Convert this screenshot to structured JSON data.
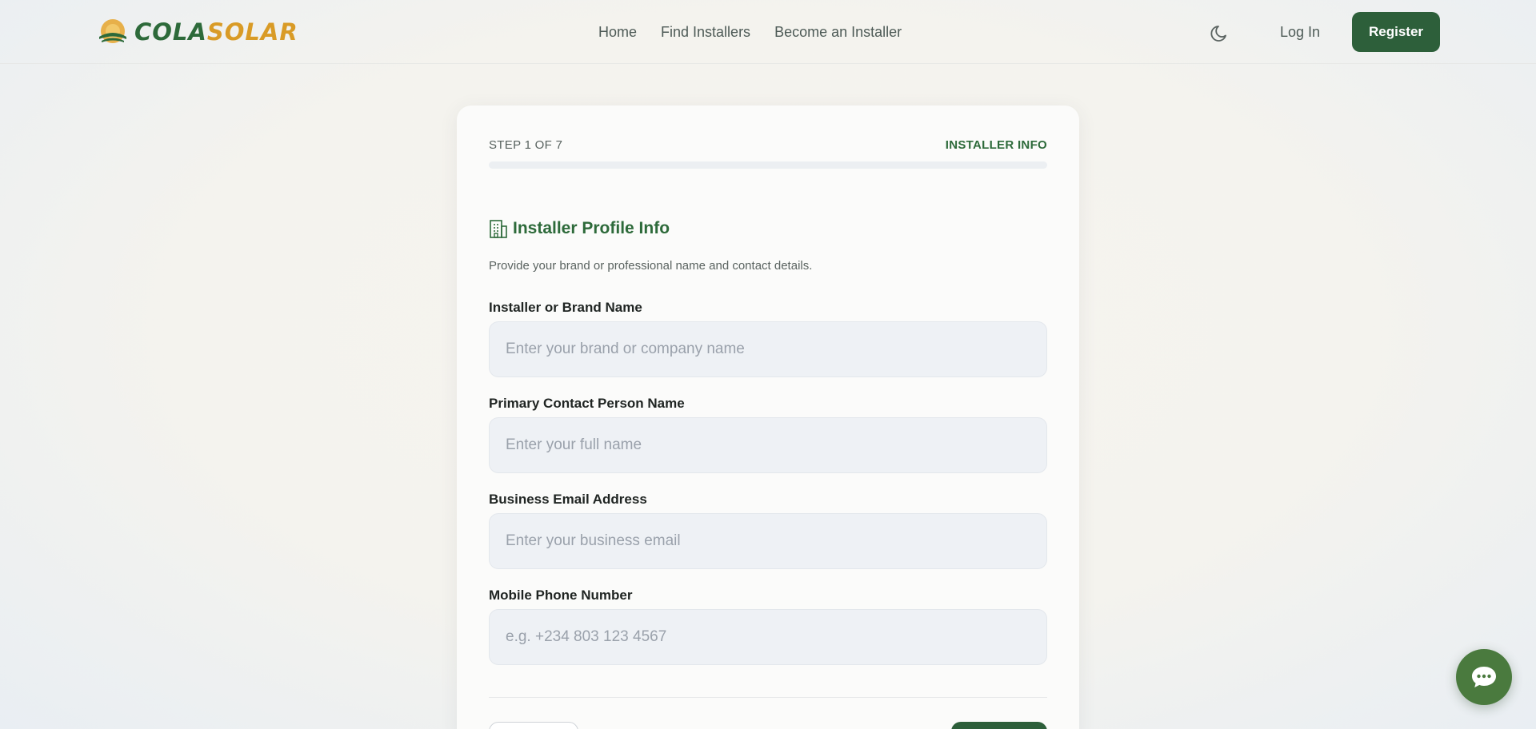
{
  "brand": {
    "logo_text_a": "COLA",
    "logo_text_b": "SOLAR"
  },
  "nav": {
    "links": [
      "Home",
      "Find Installers",
      "Become an Installer"
    ],
    "theme_icon": "moon-icon",
    "login": "Log In",
    "register": "Register"
  },
  "wizard": {
    "step": "STEP 1 OF 7",
    "step_name": "INSTALLER INFO",
    "progress_fraction": 0,
    "section_icon": "building-icon",
    "section_title": "Installer Profile Info",
    "section_desc": "Provide your brand or professional name and contact details.",
    "fields": [
      {
        "label": "Installer or Brand Name",
        "placeholder": "Enter your brand or company name",
        "value": ""
      },
      {
        "label": "Primary Contact Person Name",
        "placeholder": "Enter your full name",
        "value": ""
      },
      {
        "label": "Business Email Address",
        "placeholder": "Enter your business email",
        "value": ""
      },
      {
        "label": "Mobile Phone Number",
        "placeholder": "e.g. +234 803 123 4567",
        "value": ""
      }
    ]
  },
  "chat": {
    "icon": "chat-bubble-icon"
  },
  "colors": {
    "brand_green": "#2d6a3a",
    "brand_gold": "#d99b26",
    "button_green": "#2d5f3a",
    "chat_green": "#4a7a3e"
  }
}
